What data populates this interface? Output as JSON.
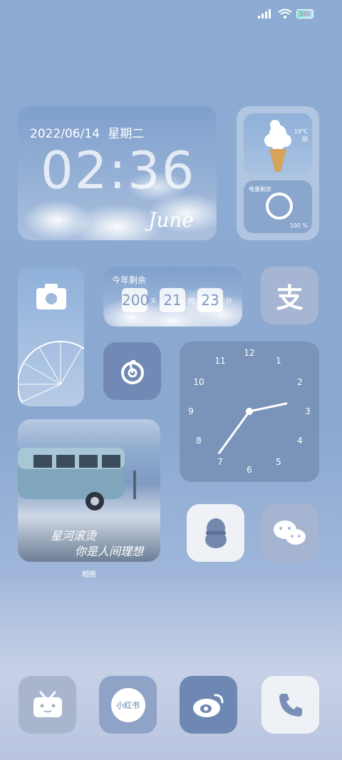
{
  "status_bar": {
    "battery": "100"
  },
  "datetime_widget": {
    "date": "2022/06/14",
    "weekday": "星期二",
    "hour": "02",
    "minute": "36",
    "month": "June"
  },
  "weather_widget": {
    "temp": "19℃",
    "condition": "阴"
  },
  "battery_widget": {
    "title": "电量剩余",
    "percent": "100 %",
    "level": 1.0
  },
  "countdown_widget": {
    "title": "今年剩余",
    "days": "200",
    "days_unit": "天",
    "hours": "21",
    "hours_unit": "时",
    "minutes": "23",
    "minutes_unit": "分"
  },
  "photo_widget": {
    "line1": "星河滚烫",
    "line2": "你是人间理想",
    "label": "相册"
  },
  "clock_widget": {
    "numbers": [
      "12",
      "1",
      "2",
      "3",
      "4",
      "5",
      "6",
      "7",
      "8",
      "9",
      "10",
      "11"
    ],
    "hour_value": 2.6,
    "minute_value": 36
  },
  "apps": {
    "alipay": {
      "glyph": "支"
    },
    "xiaohongshu": {
      "text": "小红书"
    }
  },
  "colors": {
    "tile_light": "#e9edf4",
    "tile_mid": "#aab9d3",
    "tile_dark": "#6f88b3",
    "clock_bg": "#7a93b9"
  }
}
